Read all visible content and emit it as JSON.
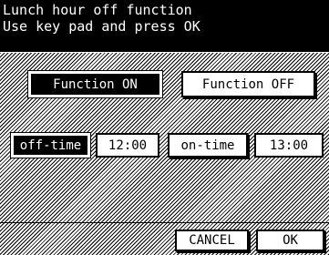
{
  "header": {
    "title": "Lunch hour off function",
    "instruction": "Use key pad and press OK"
  },
  "function_toggle": {
    "on_label": "Function ON",
    "off_label": "Function OFF"
  },
  "times": {
    "off_time_label": "off-time",
    "off_time_value": "12:00",
    "on_time_label": "on-time",
    "on_time_value": "13:00"
  },
  "footer": {
    "cancel_label": "CANCEL",
    "ok_label": "OK"
  }
}
